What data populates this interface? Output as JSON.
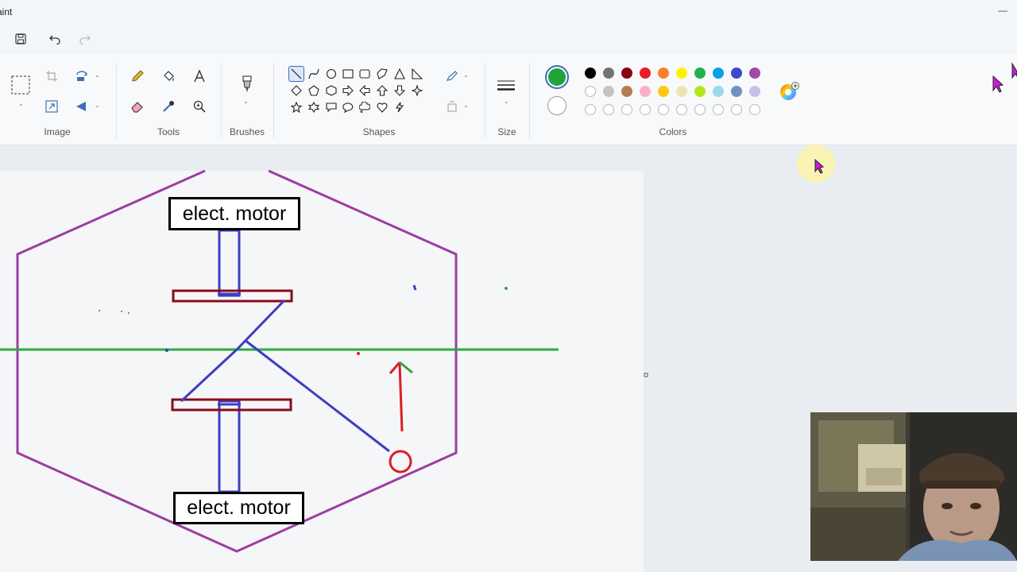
{
  "app": {
    "title": "aint"
  },
  "quick_toolbar": {
    "save": "save-icon",
    "undo": "undo-icon",
    "redo": "redo-icon"
  },
  "ribbon": {
    "groups": {
      "image": "Image",
      "tools": "Tools",
      "brushes": "Brushes",
      "shapes": "Shapes",
      "size": "Size",
      "colors": "Colors"
    },
    "primary_color": "#22a33a",
    "secondary_color": "#ffffff",
    "palette_row1": [
      "#000000",
      "#737373",
      "#880015",
      "#ed1c24",
      "#ff7f27",
      "#fff200",
      "#22b14c",
      "#00a2e8",
      "#3f48cc",
      "#a349a4"
    ],
    "palette_row2": [
      "#ffffff",
      "#c3c3c3",
      "#b97a57",
      "#ffaec9",
      "#ffc90e",
      "#efe4b0",
      "#b5e61d",
      "#99d9ea",
      "#7092be",
      "#c8bfe7"
    ]
  },
  "canvas": {
    "motor_top": "elect. motor",
    "motor_bottom": "elect. motor",
    "colors": {
      "hexagon": "#9b3ea0",
      "shaft": "#3b3fc1",
      "disk": "#8b0a1a",
      "axis": "#2ea843",
      "arrow": "#e01b24"
    }
  }
}
